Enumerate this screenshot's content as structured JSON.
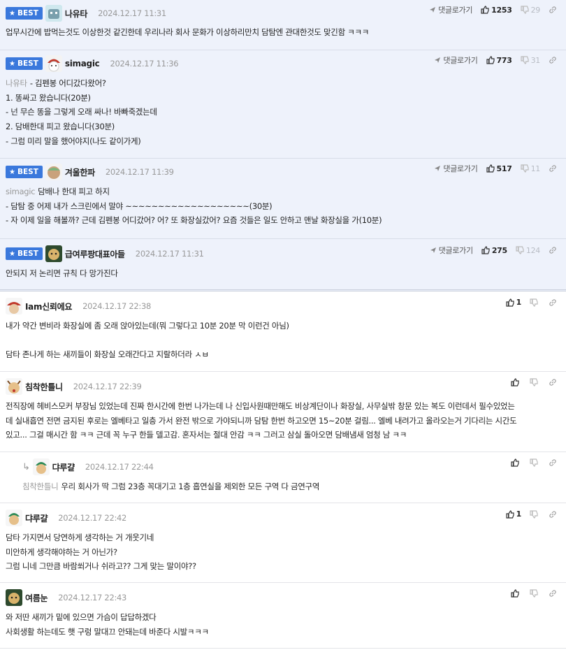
{
  "reply_label": "댓글로가기",
  "best_label": "BEST",
  "best_comments": [
    {
      "nick": "나유타",
      "date": "2024.12.17 11:31",
      "up": "1253",
      "down": "29",
      "ref": "",
      "lines": [
        "업무시간에 밥먹는것도 이상한것 같긴한데 우리나라 회사 문화가 이상하리만치 담탐엔 관대한것도 맞긴함 ㅋㅋㅋ"
      ]
    },
    {
      "nick": "simagic",
      "date": "2024.12.17 11:36",
      "up": "773",
      "down": "31",
      "ref": "나유타",
      "lines": [
        "- 김펜봉 어디갔다왔어?",
        "1. 똥싸고 왔습니다(20분)",
        "- 넌 무슨 똥을 그렇게 오래 싸나! 바빠죽겠는데",
        "2. 담배한대 피고 왔습니다(30분)",
        "- 그럼 미리 말을 했어야지(나도 같이가게)"
      ]
    },
    {
      "nick": "겨울한파",
      "date": "2024.12.17 11:39",
      "up": "517",
      "down": "11",
      "ref": "simagic",
      "lines": [
        "담배나 한대 피고 하지",
        "- 담탐 중 어제 내가 스크린에서 말야 ~~~~~~~~~~~~~~~~~~~(30분)",
        "- 자 이제 일을 해볼까? 근데 김펜봉 어디갔어? 어? 또 화장실갔어? 요즘 것들은 일도 안하고 맨날 화장실을 가(10분)"
      ]
    },
    {
      "nick": "급여루팡대표아들",
      "date": "2024.12.17 11:31",
      "up": "275",
      "down": "124",
      "ref": "",
      "lines": [
        "안되지 저 논리면 규칙 다 망가진다"
      ]
    }
  ],
  "comments": [
    {
      "nick": "Iam신뢰에요",
      "date": "2024.12.17 22:38",
      "up": "1",
      "ref": "",
      "reply": false,
      "lines": [
        "내가 약간 변비라 화장실에 좀 오래 앉아있는데(뭐 그렇다고 10분 20분 막 이런건 아님)",
        "",
        "담타 존나게 하는 새끼들이 화장실 오래간다고 지랄하더라 ㅅㅂ"
      ]
    },
    {
      "nick": "침착한틀니",
      "date": "2024.12.17 22:39",
      "up": "",
      "ref": "",
      "reply": false,
      "lines": [
        "전직장에 헤비스모커 부장님 있었는데 진짜 한시간에 한번 나가는데 나 신입사원때만해도 비상계단이나 화장실, 사무실밖 창문 있는 복도 이런데서 필수있었는",
        "데 실내흡연 전면 금지된 후로는 엘베타고 일층 가서 완전 밖으로 가야되니까 담탐 한번 하고오면 15~20분 걸림... 엘베 내려가고 올라오는거 기다리는 시간도",
        "있고... 그걸 매시간 함 ㅋㅋ 근데 꼭 누구 한들 델고감. 혼자서는 절대 안감 ㅋㅋ 그러고 삼실 돌아오면 담배냄새 엄청 남 ㅋㅋ"
      ]
    },
    {
      "nick": "댜루걀",
      "date": "2024.12.17 22:44",
      "up": "",
      "ref": "침착한틀니",
      "reply": true,
      "lines": [
        "우리 회사가 딱 그럼 23층 꼭대기고 1층 흡연실을 제외한 모든 구역 다 금연구역"
      ]
    },
    {
      "nick": "댜루걀",
      "date": "2024.12.17 22:42",
      "up": "1",
      "ref": "",
      "reply": false,
      "lines": [
        "담타 가지면서 당연하게 생각하는 거 개웃기네",
        "미안하게 생각해야하는 거 아닌가?",
        "그럼 니네 그만큼 바람쐬거나 쉬라고?? 그게 맞는 말이야??"
      ]
    },
    {
      "nick": "여름눈",
      "date": "2024.12.17 22:43",
      "up": "",
      "ref": "",
      "reply": false,
      "lines": [
        "와 저딴 새끼가 밑에 있으면 가슴이 답답하겠다",
        "사회생활 하는데도 햇 구렁 말대끄 안돼는데 바준다 시발ㅋㅋㅋ"
      ]
    }
  ]
}
